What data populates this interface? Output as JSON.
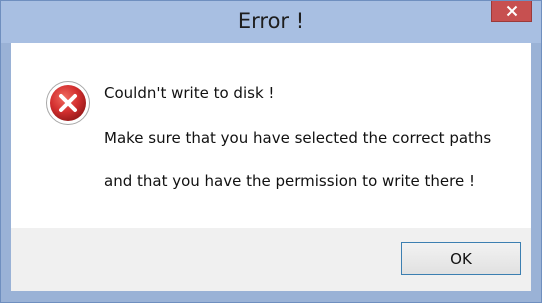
{
  "window": {
    "title": "Error !"
  },
  "message": {
    "line1": "Couldn't write to disk !",
    "line2": "Make sure that you have selected the correct paths",
    "line3": "and that you have the permission to write there !"
  },
  "buttons": {
    "ok_label": "OK"
  },
  "icons": {
    "dialog_icon": "error-x-icon",
    "close": "close-icon"
  },
  "colors": {
    "titlebar": "#a8bfe2",
    "close_button": "#c75050",
    "error_red": "#d32f2f",
    "ok_border": "#3c7fb1"
  }
}
